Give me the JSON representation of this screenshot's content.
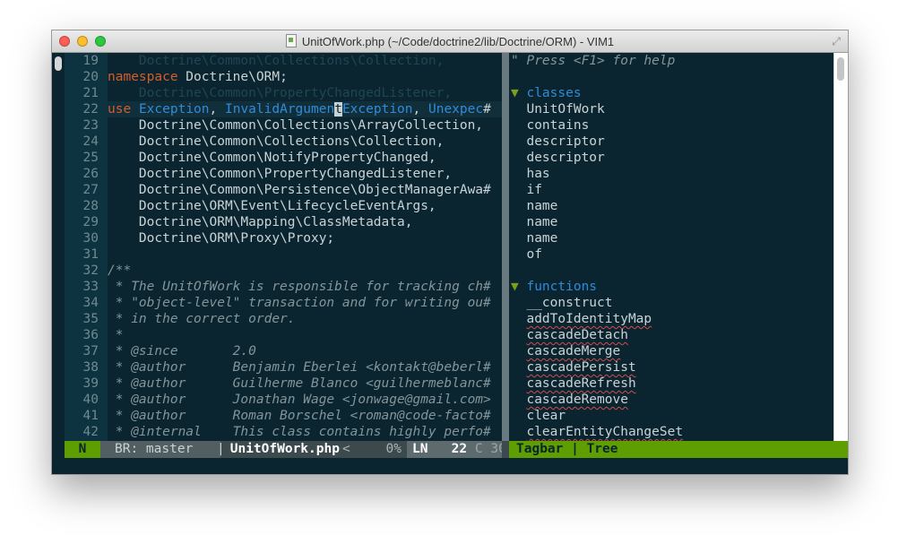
{
  "window": {
    "title": "UnitOfWork.php (~/Code/doctrine2/lib/Doctrine/ORM) - VIM1",
    "fullscreen_icon": "fullscreen-arrows-icon"
  },
  "colors": {
    "background": "#0b2530",
    "keyword": "#d35d2d",
    "class_name": "#2f8bd8",
    "comment": "#83959a",
    "mode_green": "#5f9e00"
  },
  "editor": {
    "lines": [
      {
        "num": "19",
        "text": "    Doctrine\\Common\\Collections\\Collection,",
        "dim": true
      },
      {
        "num": "20",
        "text": "namespace Doctrine\\ORM;"
      },
      {
        "num": "21",
        "text": "    Doctrine\\Common\\PropertyChangedListener,",
        "dim": true
      },
      {
        "num": "22",
        "text": "use Exception, InvalidArgumentException, Unexpec#"
      },
      {
        "num": "23",
        "text": "    Doctrine\\Common\\Collections\\ArrayCollection,"
      },
      {
        "num": "24",
        "text": "    Doctrine\\Common\\Collections\\Collection,"
      },
      {
        "num": "25",
        "text": "    Doctrine\\Common\\NotifyPropertyChanged,"
      },
      {
        "num": "26",
        "text": "    Doctrine\\Common\\PropertyChangedListener,"
      },
      {
        "num": "27",
        "text": "    Doctrine\\Common\\Persistence\\ObjectManagerAwa#"
      },
      {
        "num": "28",
        "text": "    Doctrine\\ORM\\Event\\LifecycleEventArgs,"
      },
      {
        "num": "29",
        "text": "    Doctrine\\ORM\\Mapping\\ClassMetadata,"
      },
      {
        "num": "30",
        "text": "    Doctrine\\ORM\\Proxy\\Proxy;"
      },
      {
        "num": "31",
        "text": ""
      },
      {
        "num": "32",
        "text": "/**"
      },
      {
        "num": "33",
        "text": " * The UnitOfWork is responsible for tracking ch#"
      },
      {
        "num": "34",
        "text": " * \"object-level\" transaction and for writing ou#"
      },
      {
        "num": "35",
        "text": " * in the correct order."
      },
      {
        "num": "36",
        "text": " *"
      },
      {
        "num": "37",
        "text": " * @since       2.0"
      },
      {
        "num": "38",
        "text": " * @author      Benjamin Eberlei <kontakt@beberl#"
      },
      {
        "num": "39",
        "text": " * @author      Guilherme Blanco <guilhermeblanc#"
      },
      {
        "num": "40",
        "text": " * @author      Jonathan Wage <jonwage@gmail.com>"
      },
      {
        "num": "41",
        "text": " * @author      Roman Borschel <roman@code-facto#"
      },
      {
        "num": "42",
        "text": " * @internal    This class contains highly perfo#"
      }
    ],
    "line20": {
      "kw": "namespace",
      "rest": " Doctrine\\ORM;"
    },
    "line22": {
      "kw": "use",
      "p1": " ",
      "c1": "Exception",
      "p2": ", ",
      "c2a": "InvalidArgumen",
      "cursor": "t",
      "c2b": "Exception",
      "p3": ", ",
      "c3": "Unexpec",
      "tail": "#"
    }
  },
  "tagbar": {
    "help": "\" Press <F1> for help",
    "classes_label": "classes",
    "classes": [
      "UnitOfWork",
      "contains",
      "descriptor",
      "descriptor",
      "has",
      "if",
      "name",
      "name",
      "name",
      "of"
    ],
    "functions_label": "functions",
    "functions": [
      "__construct",
      "addToIdentityMap",
      "cascadeDetach",
      "cascadeMerge",
      "cascadePersist",
      "cascadeRefresh",
      "cascadeRemove",
      "clear",
      "clearEntityChangeSet"
    ]
  },
  "statusline": {
    "mode": "N",
    "branch": "BR: master",
    "separator": "|",
    "filename": "UnitOfWork.php",
    "arrow": "<",
    "percent": "0%",
    "ln_label": "LN",
    "line": "22",
    "col_label": "C",
    "col": "30",
    "tagbar_label": "Tagbar | Tree"
  }
}
